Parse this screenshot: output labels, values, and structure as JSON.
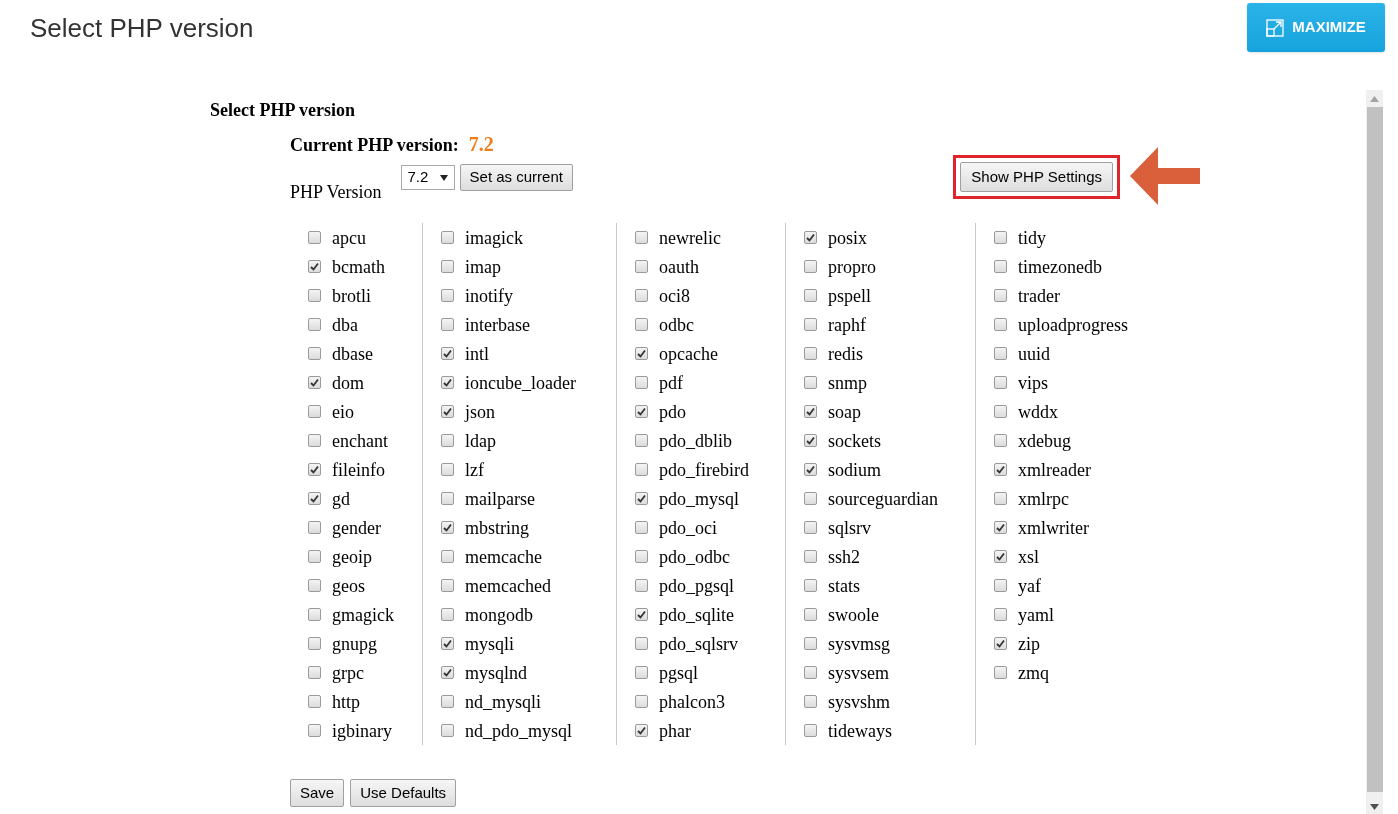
{
  "page_title": "Select PHP version",
  "maximize_button": {
    "label": "MAXIMIZE"
  },
  "panel": {
    "heading": "Select PHP version",
    "current_label": "Current PHP version:",
    "current_value": "7.2",
    "version_label": "PHP Version",
    "version_select": {
      "value": "7.2"
    },
    "set_current_button": "Set as current",
    "show_settings_button": {
      "label": "Show PHP Settings",
      "highlighted": true
    }
  },
  "extensions": [
    [
      {
        "label": "apcu",
        "checked": false
      },
      {
        "label": "bcmath",
        "checked": true
      },
      {
        "label": "brotli",
        "checked": false
      },
      {
        "label": "dba",
        "checked": false
      },
      {
        "label": "dbase",
        "checked": false
      },
      {
        "label": "dom",
        "checked": true
      },
      {
        "label": "eio",
        "checked": false
      },
      {
        "label": "enchant",
        "checked": false
      },
      {
        "label": "fileinfo",
        "checked": true
      },
      {
        "label": "gd",
        "checked": true
      },
      {
        "label": "gender",
        "checked": false
      },
      {
        "label": "geoip",
        "checked": false
      },
      {
        "label": "geos",
        "checked": false
      },
      {
        "label": "gmagick",
        "checked": false
      },
      {
        "label": "gnupg",
        "checked": false
      },
      {
        "label": "grpc",
        "checked": false
      },
      {
        "label": "http",
        "checked": false
      },
      {
        "label": "igbinary",
        "checked": false
      }
    ],
    [
      {
        "label": "imagick",
        "checked": false
      },
      {
        "label": "imap",
        "checked": false
      },
      {
        "label": "inotify",
        "checked": false
      },
      {
        "label": "interbase",
        "checked": false
      },
      {
        "label": "intl",
        "checked": true
      },
      {
        "label": "ioncube_loader",
        "checked": true
      },
      {
        "label": "json",
        "checked": true
      },
      {
        "label": "ldap",
        "checked": false
      },
      {
        "label": "lzf",
        "checked": false
      },
      {
        "label": "mailparse",
        "checked": false
      },
      {
        "label": "mbstring",
        "checked": true
      },
      {
        "label": "memcache",
        "checked": false
      },
      {
        "label": "memcached",
        "checked": false
      },
      {
        "label": "mongodb",
        "checked": false
      },
      {
        "label": "mysqli",
        "checked": true
      },
      {
        "label": "mysqlnd",
        "checked": true
      },
      {
        "label": "nd_mysqli",
        "checked": false
      },
      {
        "label": "nd_pdo_mysql",
        "checked": false
      }
    ],
    [
      {
        "label": "newrelic",
        "checked": false
      },
      {
        "label": "oauth",
        "checked": false
      },
      {
        "label": "oci8",
        "checked": false
      },
      {
        "label": "odbc",
        "checked": false
      },
      {
        "label": "opcache",
        "checked": true
      },
      {
        "label": "pdf",
        "checked": false
      },
      {
        "label": "pdo",
        "checked": true
      },
      {
        "label": "pdo_dblib",
        "checked": false
      },
      {
        "label": "pdo_firebird",
        "checked": false
      },
      {
        "label": "pdo_mysql",
        "checked": true
      },
      {
        "label": "pdo_oci",
        "checked": false
      },
      {
        "label": "pdo_odbc",
        "checked": false
      },
      {
        "label": "pdo_pgsql",
        "checked": false
      },
      {
        "label": "pdo_sqlite",
        "checked": true
      },
      {
        "label": "pdo_sqlsrv",
        "checked": false
      },
      {
        "label": "pgsql",
        "checked": false
      },
      {
        "label": "phalcon3",
        "checked": false
      },
      {
        "label": "phar",
        "checked": true
      }
    ],
    [
      {
        "label": "posix",
        "checked": true
      },
      {
        "label": "propro",
        "checked": false
      },
      {
        "label": "pspell",
        "checked": false
      },
      {
        "label": "raphf",
        "checked": false
      },
      {
        "label": "redis",
        "checked": false
      },
      {
        "label": "snmp",
        "checked": false
      },
      {
        "label": "soap",
        "checked": true
      },
      {
        "label": "sockets",
        "checked": true
      },
      {
        "label": "sodium",
        "checked": true
      },
      {
        "label": "sourceguardian",
        "checked": false
      },
      {
        "label": "sqlsrv",
        "checked": false
      },
      {
        "label": "ssh2",
        "checked": false
      },
      {
        "label": "stats",
        "checked": false
      },
      {
        "label": "swoole",
        "checked": false
      },
      {
        "label": "sysvmsg",
        "checked": false
      },
      {
        "label": "sysvsem",
        "checked": false
      },
      {
        "label": "sysvshm",
        "checked": false
      },
      {
        "label": "tideways",
        "checked": false
      }
    ],
    [
      {
        "label": "tidy",
        "checked": false
      },
      {
        "label": "timezonedb",
        "checked": false
      },
      {
        "label": "trader",
        "checked": false
      },
      {
        "label": "uploadprogress",
        "checked": false
      },
      {
        "label": "uuid",
        "checked": false
      },
      {
        "label": "vips",
        "checked": false
      },
      {
        "label": "wddx",
        "checked": false
      },
      {
        "label": "xdebug",
        "checked": false
      },
      {
        "label": "xmlreader",
        "checked": true
      },
      {
        "label": "xmlrpc",
        "checked": false
      },
      {
        "label": "xmlwriter",
        "checked": true
      },
      {
        "label": "xsl",
        "checked": true
      },
      {
        "label": "yaf",
        "checked": false
      },
      {
        "label": "yaml",
        "checked": false
      },
      {
        "label": "zip",
        "checked": true
      },
      {
        "label": "zmq",
        "checked": false
      }
    ]
  ],
  "footer_buttons": [
    "Save",
    "Use Defaults"
  ]
}
